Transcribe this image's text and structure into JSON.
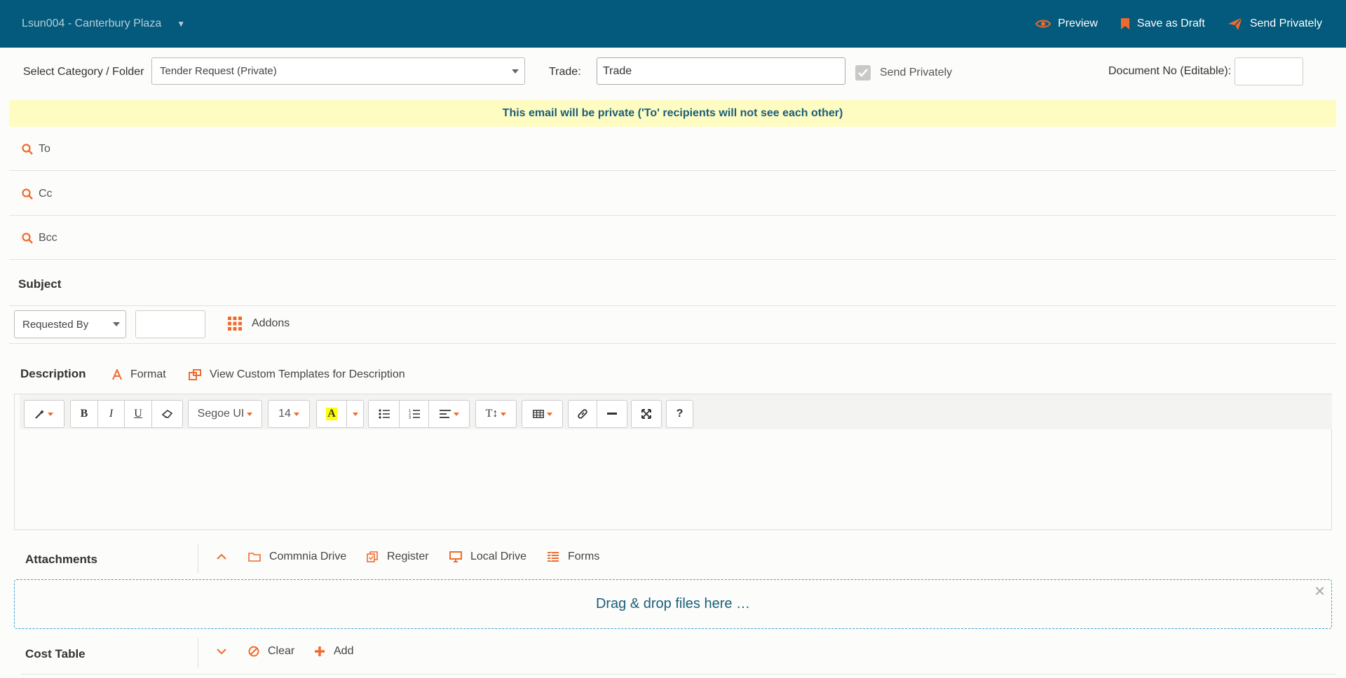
{
  "header": {
    "project": "Lsun004 - Canterbury Plaza",
    "actions": {
      "preview": "Preview",
      "save_draft": "Save as Draft",
      "send": "Send Privately"
    }
  },
  "form": {
    "category_label": "Select Category / Folder",
    "category_value": "Tender Request (Private)",
    "trade_label": "Trade:",
    "trade_value": "Trade",
    "send_privately_label": "Send Privately",
    "docno_label": "Document No (Editable):",
    "docno_value": ""
  },
  "banner": "This email will be private ('To' recipients will not see each other)",
  "recipients": {
    "to": "To",
    "cc": "Cc",
    "bcc": "Bcc"
  },
  "subject_label": "Subject",
  "requested_by": {
    "value": "Requested By",
    "input": ""
  },
  "addons_label": "Addons",
  "description": {
    "title": "Description",
    "format": "Format",
    "templates": "View Custom Templates for Description"
  },
  "toolbar": {
    "bold": "B",
    "italic": "I",
    "underline": "U",
    "font_name": "Segoe UI",
    "font_size": "14",
    "highlight": "A",
    "text_size": "T↕",
    "help": "?"
  },
  "attachments": {
    "title": "Attachments",
    "commnia_drive": "Commnia Drive",
    "register": "Register",
    "local_drive": "Local Drive",
    "forms": "Forms",
    "dropzone": "Drag & drop files here …"
  },
  "cost_table": {
    "title": "Cost Table",
    "clear": "Clear",
    "add": "Add"
  },
  "colors": {
    "header_bg": "#045a7c",
    "accent": "#ef6b2d",
    "banner_bg": "#fffcc2",
    "banner_text": "#1a5e7a"
  }
}
